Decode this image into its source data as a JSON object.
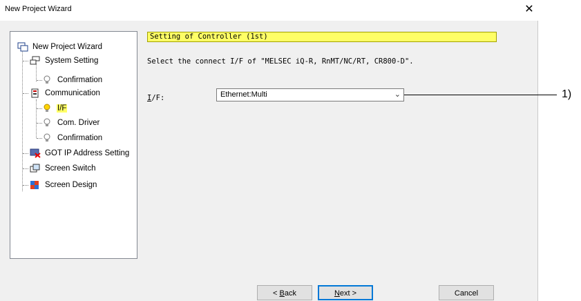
{
  "window": {
    "title": "New Project Wizard"
  },
  "tree": {
    "items": [
      {
        "label": "New Project Wizard",
        "icon": "wizard-icon"
      },
      {
        "label": "System Setting",
        "icon": "system-setting-icon"
      },
      {
        "label": "Confirmation",
        "icon": "bulb-icon"
      },
      {
        "label": "Communication",
        "icon": "communication-icon"
      },
      {
        "label": "I/F",
        "icon": "bulb-active-icon",
        "selected": true
      },
      {
        "label": "Com. Driver",
        "icon": "bulb-icon"
      },
      {
        "label": "Confirmation",
        "icon": "bulb-icon"
      },
      {
        "label": "GOT IP Address Setting",
        "icon": "ip-address-icon"
      },
      {
        "label": "Screen Switch",
        "icon": "screen-switch-icon"
      },
      {
        "label": "Screen Design",
        "icon": "screen-design-icon"
      }
    ]
  },
  "main": {
    "section_title": "Setting of Controller (1st)",
    "description": "Select the connect I/F of \"MELSEC iQ-R, RnMT/NC/RT, CR800-D\".",
    "if_label": "I/F:",
    "if_value": "Ethernet:Multi"
  },
  "callout": "1)",
  "buttons": {
    "back": "< Back",
    "next": "Next >",
    "cancel": "Cancel"
  },
  "colors": {
    "highlight": "#ffff66",
    "accent": "#0078d7"
  }
}
